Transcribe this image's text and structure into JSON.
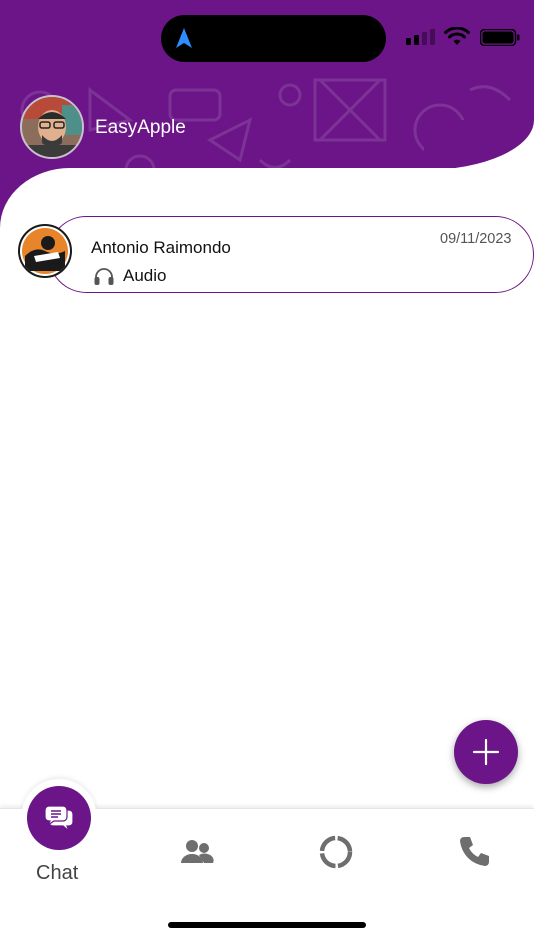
{
  "colors": {
    "brand": "#6b1588",
    "white": "#ffffff"
  },
  "status_bar": {
    "icons": [
      "navigation-arrow-icon",
      "cellular-signal-icon",
      "wifi-icon",
      "battery-icon"
    ]
  },
  "header": {
    "user_name": "EasyApple",
    "avatar": "profile-avatar"
  },
  "chats": [
    {
      "name": "Antonio Raimondo",
      "date": "09/11/2023",
      "preview": "Audio",
      "preview_icon": "headphones-icon"
    }
  ],
  "fab": {
    "icon": "plus-icon"
  },
  "bottom_nav": {
    "items": [
      {
        "label": "Chat",
        "icon": "chat-bubbles-icon",
        "active": true
      },
      {
        "label": "",
        "icon": "contacts-icon",
        "active": false
      },
      {
        "label": "",
        "icon": "status-ring-icon",
        "active": false
      },
      {
        "label": "",
        "icon": "phone-icon",
        "active": false
      }
    ]
  }
}
